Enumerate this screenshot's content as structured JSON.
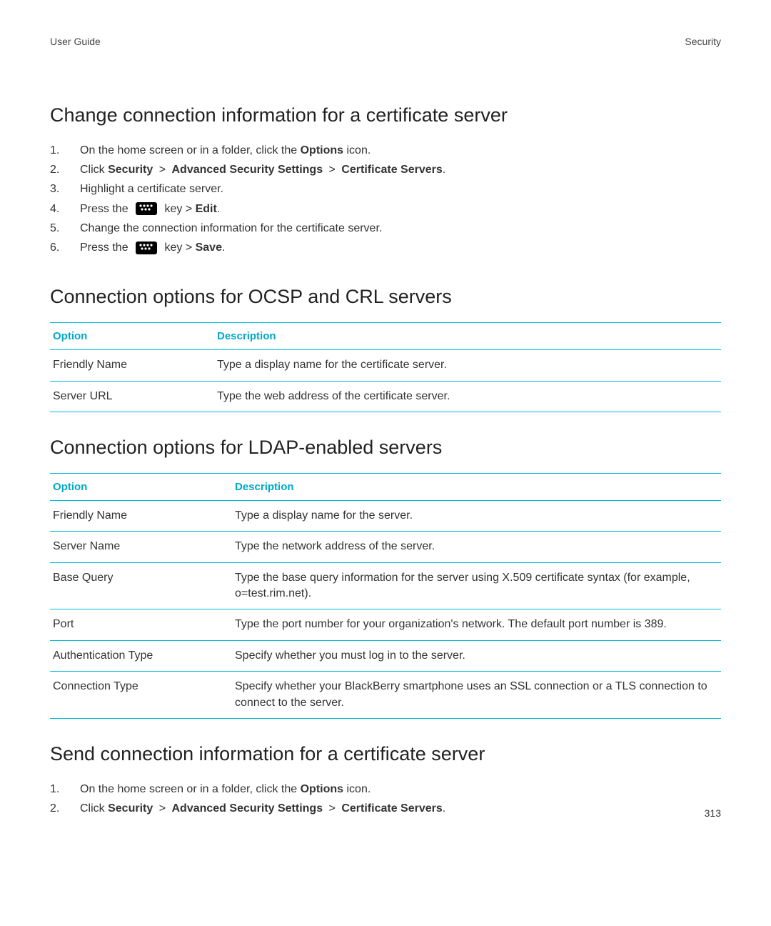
{
  "header": {
    "left": "User Guide",
    "right": "Security"
  },
  "footer": {
    "page_number": "313"
  },
  "section1": {
    "title": "Change connection information for a certificate server",
    "steps": [
      {
        "pre": "On the home screen or in a folder, click the ",
        "bold1": "Options",
        "post1": " icon."
      },
      {
        "pre": "Click ",
        "bold1": "Security",
        "gt1": " > ",
        "bold2": "Advanced Security Settings",
        "gt2": " > ",
        "bold3": "Certificate Servers",
        "post3": "."
      },
      {
        "pre": "Highlight a certificate server."
      },
      {
        "pre": "Press the ",
        "has_icon": true,
        "mid": "  key > ",
        "bold1": "Edit",
        "post1": "."
      },
      {
        "pre": "Change the connection information for the certificate server."
      },
      {
        "pre": "Press the ",
        "has_icon": true,
        "mid": "  key > ",
        "bold1": "Save",
        "post1": "."
      }
    ]
  },
  "section2": {
    "title": "Connection options for OCSP and CRL servers",
    "table": {
      "head_option": "Option",
      "head_description": "Description",
      "rows": [
        {
          "option": "Friendly Name",
          "description": "Type a display name for the certificate server."
        },
        {
          "option": "Server URL",
          "description": "Type the web address of the certificate server."
        }
      ]
    }
  },
  "section3": {
    "title": "Connection options for LDAP-enabled servers",
    "table": {
      "head_option": "Option",
      "head_description": "Description",
      "rows": [
        {
          "option": "Friendly Name",
          "description": "Type a display name for the server."
        },
        {
          "option": "Server Name",
          "description": "Type the network address of the server."
        },
        {
          "option": "Base Query",
          "description": "Type the base query information for the server using X.509 certificate syntax (for example, o=test.rim.net)."
        },
        {
          "option": "Port",
          "description": "Type the port number for your organization's network. The default port number is 389."
        },
        {
          "option": "Authentication Type",
          "description": "Specify whether you must log in to the server."
        },
        {
          "option": "Connection Type",
          "description": "Specify whether your BlackBerry smartphone uses an SSL connection or a TLS connection to connect to the server."
        }
      ]
    }
  },
  "section4": {
    "title": "Send connection information for a certificate server",
    "steps": [
      {
        "pre": "On the home screen or in a folder, click the ",
        "bold1": "Options",
        "post1": " icon."
      },
      {
        "pre": "Click ",
        "bold1": "Security",
        "gt1": " > ",
        "bold2": "Advanced Security Settings",
        "gt2": " > ",
        "bold3": "Certificate Servers",
        "post3": "."
      }
    ]
  }
}
